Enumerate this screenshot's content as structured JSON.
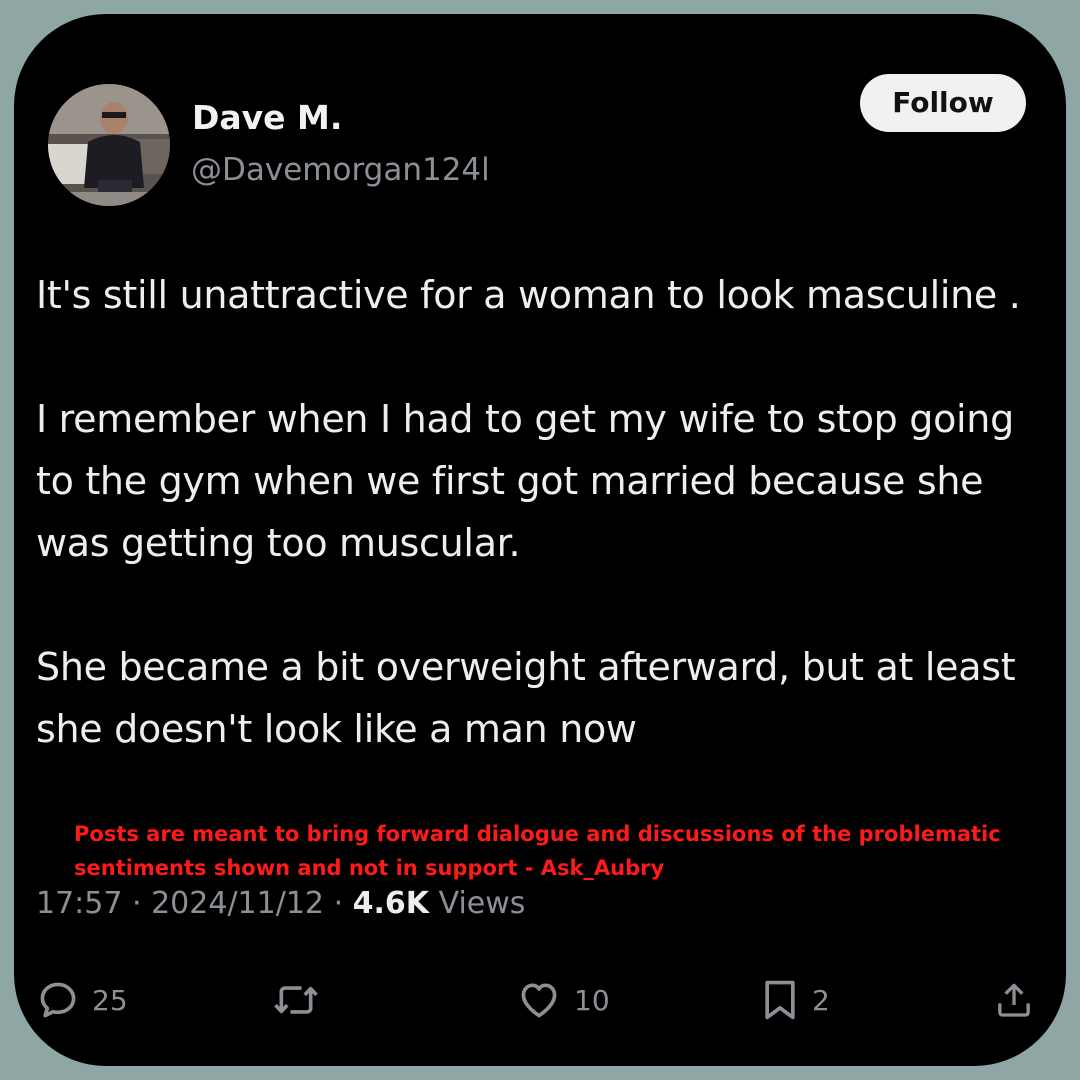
{
  "post": {
    "display_name": "Dave M.",
    "handle": "@Davemorgan124l",
    "follow_label": "Follow",
    "paragraphs": [
      "It's still unattractive for a woman to look masculine .",
      "I remember when I had to get my wife to stop going to the gym when we first got married because she was getting too muscular.",
      "She became a bit overweight afterward, but at least she doesn't look like a man now"
    ],
    "disclaimer": "Posts are meant to bring forward dialogue and discussions of the problematic sentiments shown and not in support - Ask_Aubry",
    "meta": {
      "time": "17:57",
      "date": "2024/11/12",
      "views_count": "4.6K",
      "views_label": "Views"
    }
  },
  "actions": {
    "reply_count": "25",
    "repost_count": "",
    "like_count": "10",
    "bookmark_count": "2"
  },
  "icons": {
    "reply": "speech-bubble-icon",
    "repost": "repost-arrows-icon",
    "like": "heart-icon",
    "bookmark": "bookmark-icon",
    "share": "share-upload-icon"
  },
  "colors": {
    "background": "#8ea7a4",
    "card": "#000000",
    "text": "#eceef0",
    "muted": "#8b9097",
    "disclaimer": "#ff1a1a",
    "follow_bg": "#eff1f3"
  }
}
